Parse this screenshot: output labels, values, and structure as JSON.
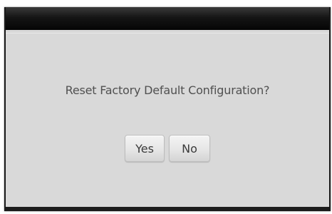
{
  "dialog": {
    "message": "Reset Factory Default Configuration?",
    "buttons": {
      "yes_label": "Yes",
      "no_label": "No"
    }
  },
  "colors": {
    "dialog_background": "#d9d9d9",
    "titlebar": "#0a0a0a",
    "text": "#505050"
  }
}
